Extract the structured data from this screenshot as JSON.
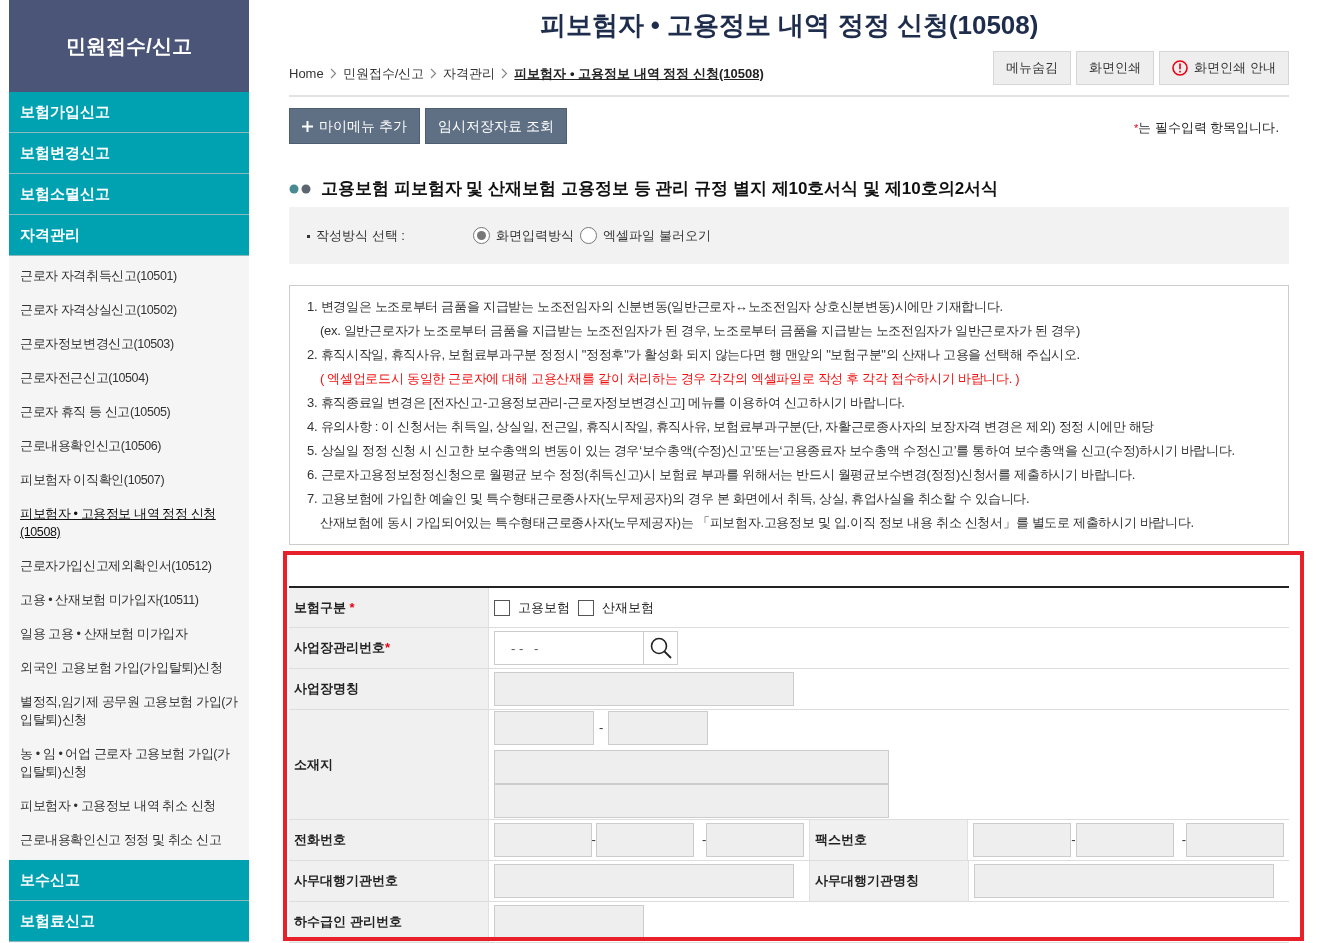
{
  "sidebar": {
    "title": "민원접수/신고",
    "sections": [
      {
        "label": "보험가입신고"
      },
      {
        "label": "보험변경신고"
      },
      {
        "label": "보험소멸신고"
      },
      {
        "label": "자격관리",
        "children": [
          {
            "label": "근로자 자격취득신고(10501)",
            "selected": false
          },
          {
            "label": "근로자 자격상실신고(10502)",
            "selected": false
          },
          {
            "label": "근로자정보변경신고(10503)",
            "selected": false
          },
          {
            "label": "근로자전근신고(10504)",
            "selected": false
          },
          {
            "label": "근로자 휴직 등 신고(10505)",
            "selected": false
          },
          {
            "label": "근로내용확인신고(10506)",
            "selected": false
          },
          {
            "label": "피보험자 이직확인(10507)",
            "selected": false
          },
          {
            "label": "피보험자 • 고용정보 내역 정정 신청(10508)",
            "selected": true
          },
          {
            "label": "근로자가입신고제외확인서(10512)",
            "selected": false
          },
          {
            "label": "고용 • 산재보험 미가입자(10511)",
            "selected": false
          },
          {
            "label": "일용 고용 • 산재보험 미가입자",
            "selected": false
          },
          {
            "label": "외국인 고용보험 가입(가입탈퇴)신청",
            "selected": false
          },
          {
            "label": "별정직,임기제 공무원 고용보험 가입(가입탈퇴)신청",
            "selected": false
          },
          {
            "label": "농 • 임 • 어업 근로자 고용보험 가입(가입탈퇴)신청",
            "selected": false
          },
          {
            "label": "피보험자 • 고용정보 내역 취소 신청",
            "selected": false
          },
          {
            "label": "근로내용확인신고 정정 및 취소 신고",
            "selected": false
          }
        ]
      },
      {
        "label": "보수신고"
      },
      {
        "label": "보험료신고"
      }
    ]
  },
  "title": "피보험자 • 고용정보 내역 정정 신청(10508)",
  "breadcrumb": [
    {
      "label": "Home",
      "current": false
    },
    {
      "label": "민원접수/신고",
      "current": false
    },
    {
      "label": "자격관리",
      "current": false
    },
    {
      "label": "피보험자 • 고용정보 내역 정정 신청(10508)",
      "current": true
    }
  ],
  "header_buttons": [
    {
      "label": "메뉴숨김",
      "kind": "plain"
    },
    {
      "label": "화면인쇄",
      "kind": "plain"
    },
    {
      "label": "화면인쇄 안내",
      "kind": "info"
    }
  ],
  "toolbar_buttons": [
    {
      "label": "마이메뉴 추가",
      "kind": "add"
    },
    {
      "label": "임시저장자료 조회",
      "kind": "plain"
    }
  ],
  "required_note": {
    "mark": "*",
    "text": "는 필수입력 항목입니다."
  },
  "section_title": "고용보험 피보험자 및 산재보험 고용정보 등 관리 규정 별지 제10호서식 및 제10호의2서식",
  "input_method": {
    "label": "작성방식 선택 :",
    "options": [
      {
        "label": "화면입력방식",
        "selected": true
      },
      {
        "label": "엑셀파일 불러오기",
        "selected": false
      }
    ]
  },
  "notes": [
    {
      "lines": [
        {
          "text": "1. 변경일은 노조로부터 금품을 지급받는 노조전임자의 신분변동(일반근로자↔노조전임자 상호신분변동)시에만 기재합니다.",
          "kind": "normal"
        },
        {
          "text": "(ex. 일반근로자가 노조로부터 금품을 지급받는 노조전임자가 된 경우, 노조로부터 금품을 지급받는 노조전임자가 일반근로자가 된 경우)",
          "kind": "normal"
        }
      ]
    },
    {
      "lines": [
        {
          "text": "2. 휴직시작일, 휴직사유, 보험료부과구분 정정시 \"정정후\"가 활성화 되지 않는다면 행 맨앞의 \"보험구분\"의 산재나 고용을 선택해 주십시오.",
          "kind": "normal"
        },
        {
          "text": "( 엑셀업로드시 동일한 근로자에 대해 고용산재를 같이 처리하는 경우 각각의 엑셀파일로 작성 후 각각 접수하시기 바랍니다. )",
          "kind": "warning"
        }
      ]
    },
    {
      "lines": [
        {
          "text": "3. 휴직종료일 변경은 [전자신고-고용정보관리-근로자정보변경신고] 메뉴를 이용하여 신고하시기 바랍니다.",
          "kind": "normal"
        }
      ]
    },
    {
      "lines": [
        {
          "text": "4. 유의사항 : 이 신청서는 취득일, 상실일, 전근일, 휴직시작일, 휴직사유, 보험료부과구분(단, 자활근로종사자의 보장자격 변경은 제외) 정정 시에만 해당",
          "kind": "normal"
        }
      ]
    },
    {
      "lines": [
        {
          "text": "5. 상실일 정정 신청 시 신고한 보수총액의 변동이 있는 경우‘보수총액(수정)신고’또는‘고용종료자 보수총액 수정신고’를 통하여 보수총액을 신고(수정)하시기 바랍니다.",
          "kind": "normal"
        }
      ]
    },
    {
      "lines": [
        {
          "text": "6. 근로자고용정보정정신청으로 월평균 보수 정정(취득신고)시 보험료 부과를 위해서는 반드시 월평균보수변경(정정)신청서를 제출하시기 바랍니다.",
          "kind": "normal"
        }
      ]
    },
    {
      "lines": [
        {
          "text": "7. 고용보험에 가입한 예술인 및 특수형태근로종사자(노무제공자)의 경우 본 화면에서 취득, 상실, 휴업사실을 취소할 수 있습니다.",
          "kind": "normal"
        },
        {
          "text": "산재보험에 동시 가입되어있는 특수형태근로종사자(노무제공자)는 「피보험자.고용정보 및 입.이직 정보 내용 취소 신청서」를 별도로 제출하시기 바랍니다.",
          "kind": "normal"
        }
      ]
    }
  ],
  "form": [
    {
      "kind": "checkboxes",
      "label": "보험구분",
      "mark": " *",
      "options": [
        {
          "label": "고용보험",
          "checked": false
        },
        {
          "label": "산재보험",
          "checked": false
        }
      ]
    },
    {
      "kind": "search",
      "label": "사업장관리번호",
      "mark": "*",
      "placeholder": "- -   -"
    },
    {
      "kind": "text",
      "label": "사업장명칭"
    },
    {
      "kind": "address",
      "label": "소재지",
      "separator": "-"
    },
    {
      "kind": "phones",
      "cells": [
        {
          "label": "전화번호",
          "separators": [
            "-",
            "-"
          ]
        },
        {
          "label": "팩스번호",
          "separators": [
            "-",
            "-"
          ]
        }
      ]
    },
    {
      "kind": "pair",
      "cells": [
        {
          "label": "사무대행기관번호"
        },
        {
          "label": "사무대행기관명칭"
        }
      ]
    },
    {
      "kind": "short",
      "label": "하수급인 관리번호"
    }
  ]
}
